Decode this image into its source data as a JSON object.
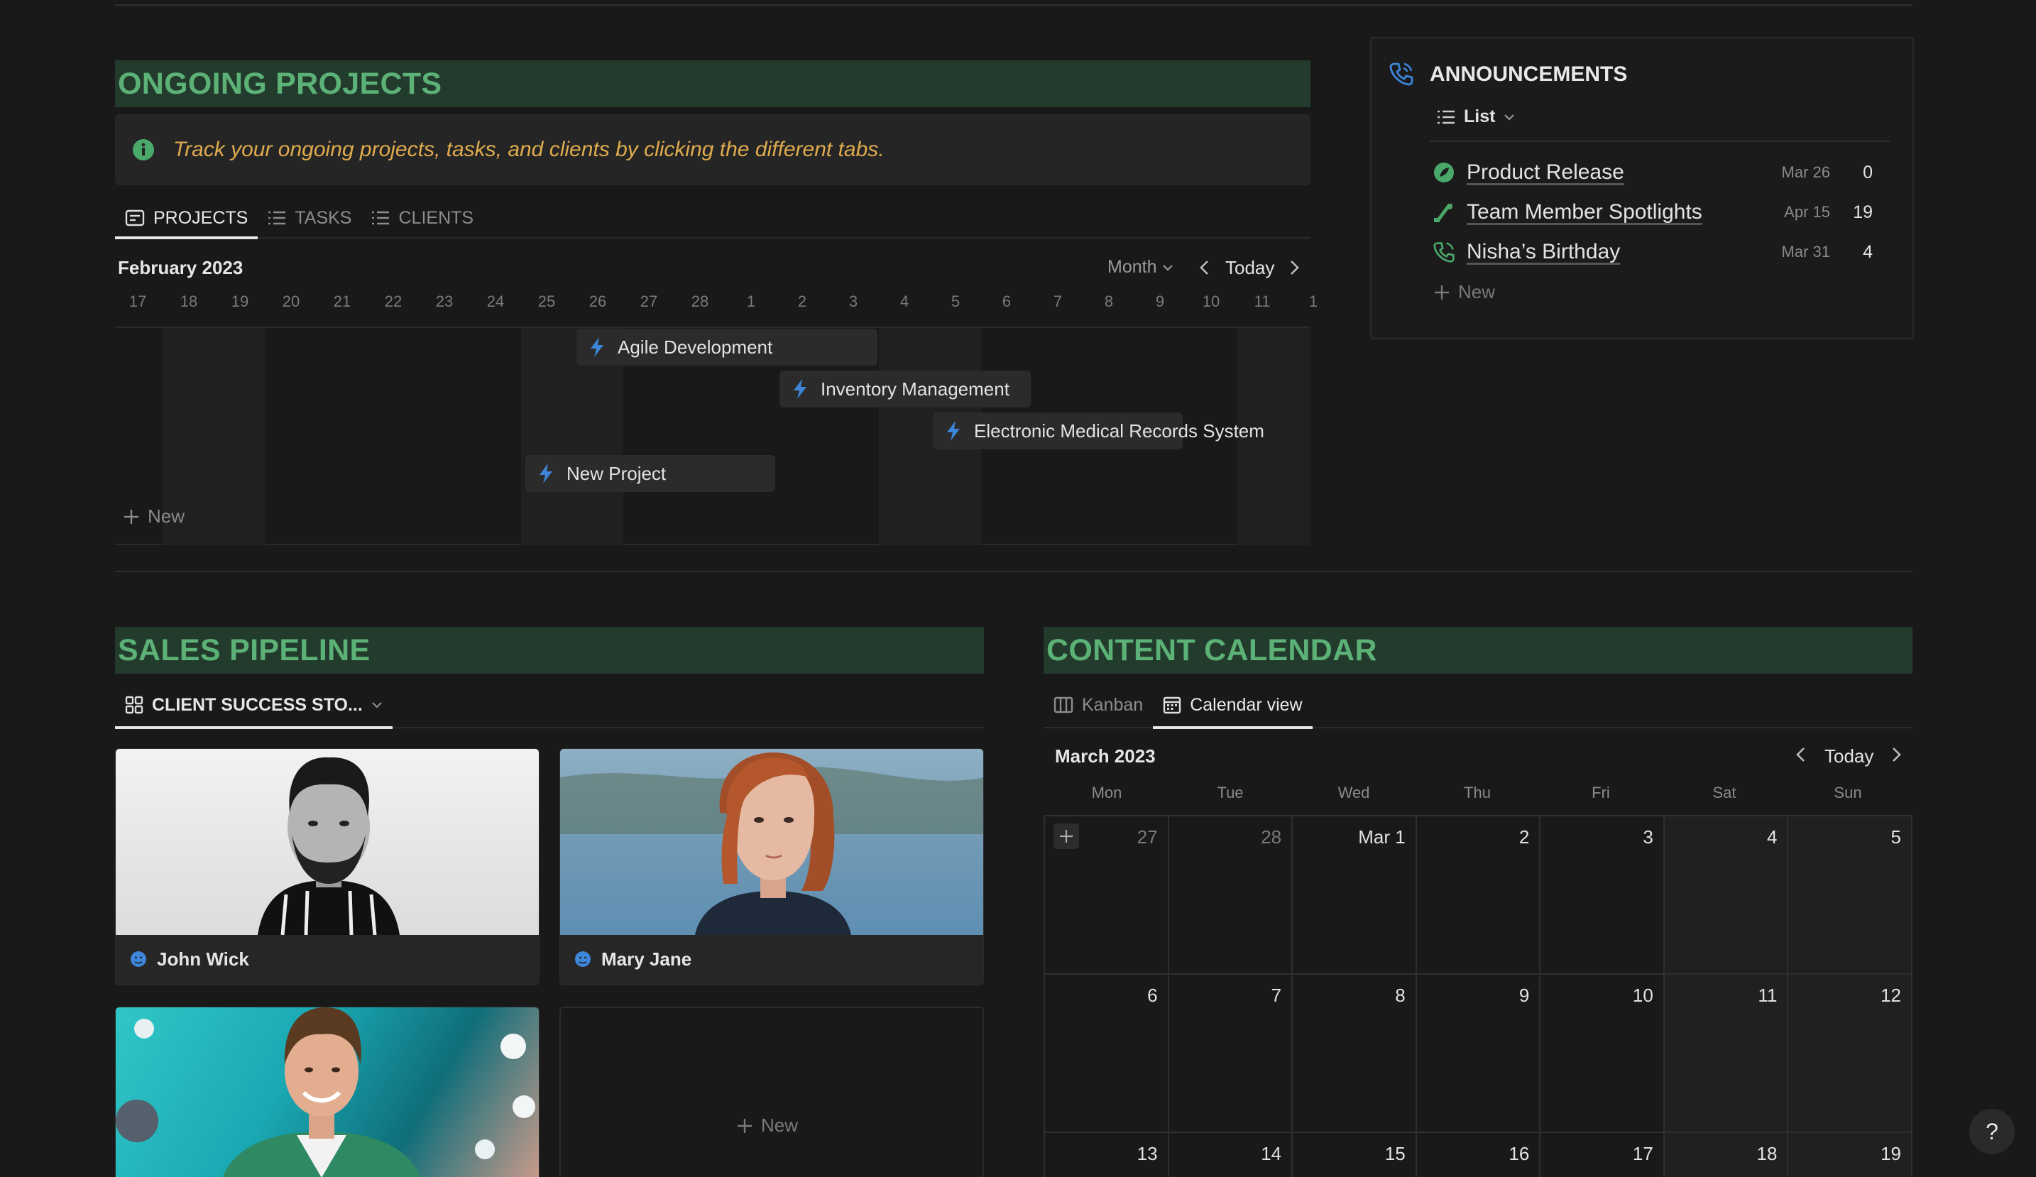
{
  "ongoing": {
    "title": "ONGOING PROJECTS",
    "callout": "Track your ongoing projects, tasks, and clients by clicking the different tabs.",
    "tabs": [
      {
        "label": "PROJECTS"
      },
      {
        "label": "TASKS"
      },
      {
        "label": "CLIENTS"
      }
    ],
    "timeline": {
      "month_label": "February 2023",
      "view_select": "Month",
      "today_label": "Today",
      "days": [
        "17",
        "18",
        "19",
        "20",
        "21",
        "22",
        "23",
        "24",
        "25",
        "26",
        "27",
        "28",
        "1",
        "2",
        "3",
        "4",
        "5",
        "6",
        "7",
        "8",
        "9",
        "10",
        "11",
        "1"
      ],
      "bars": [
        {
          "label": "Agile Development"
        },
        {
          "label": "Inventory Management"
        },
        {
          "label": "Electronic Medical Records System"
        },
        {
          "label": "New Project"
        }
      ],
      "new_label": "New"
    }
  },
  "announcements": {
    "title": "ANNOUNCEMENTS",
    "view_label": "List",
    "items": [
      {
        "label": "Product Release",
        "date": "Mar 26",
        "count": "0"
      },
      {
        "label": "Team Member Spotlights",
        "date": "Apr 15",
        "count": "19"
      },
      {
        "label": "Nisha’s Birthday",
        "date": "Mar 31",
        "count": "4"
      }
    ],
    "new_label": "New"
  },
  "sales": {
    "title": "SALES PIPELINE",
    "view_label": "CLIENT SUCCESS STO...",
    "cards": [
      {
        "name": "John Wick"
      },
      {
        "name": "Mary Jane"
      }
    ],
    "new_label": "New"
  },
  "content_calendar": {
    "title": "CONTENT CALENDAR",
    "tabs": [
      {
        "label": "Kanban"
      },
      {
        "label": "Calendar view"
      }
    ],
    "month_label": "March 2023",
    "today_label": "Today",
    "weekdays": [
      "Mon",
      "Tue",
      "Wed",
      "Thu",
      "Fri",
      "Sat",
      "Sun"
    ],
    "weeks": [
      [
        "27",
        "28",
        "Mar 1",
        "2",
        "3",
        "4",
        "5"
      ],
      [
        "6",
        "7",
        "8",
        "9",
        "10",
        "11",
        "12"
      ],
      [
        "13",
        "14",
        "15",
        "16",
        "17",
        "18",
        "19"
      ]
    ]
  },
  "help_label": "?",
  "colors": {
    "section_bg": "#233b2c",
    "section_text": "#5bb176",
    "accent_blue": "#3d86d9",
    "callout_text": "#dfab4d"
  }
}
